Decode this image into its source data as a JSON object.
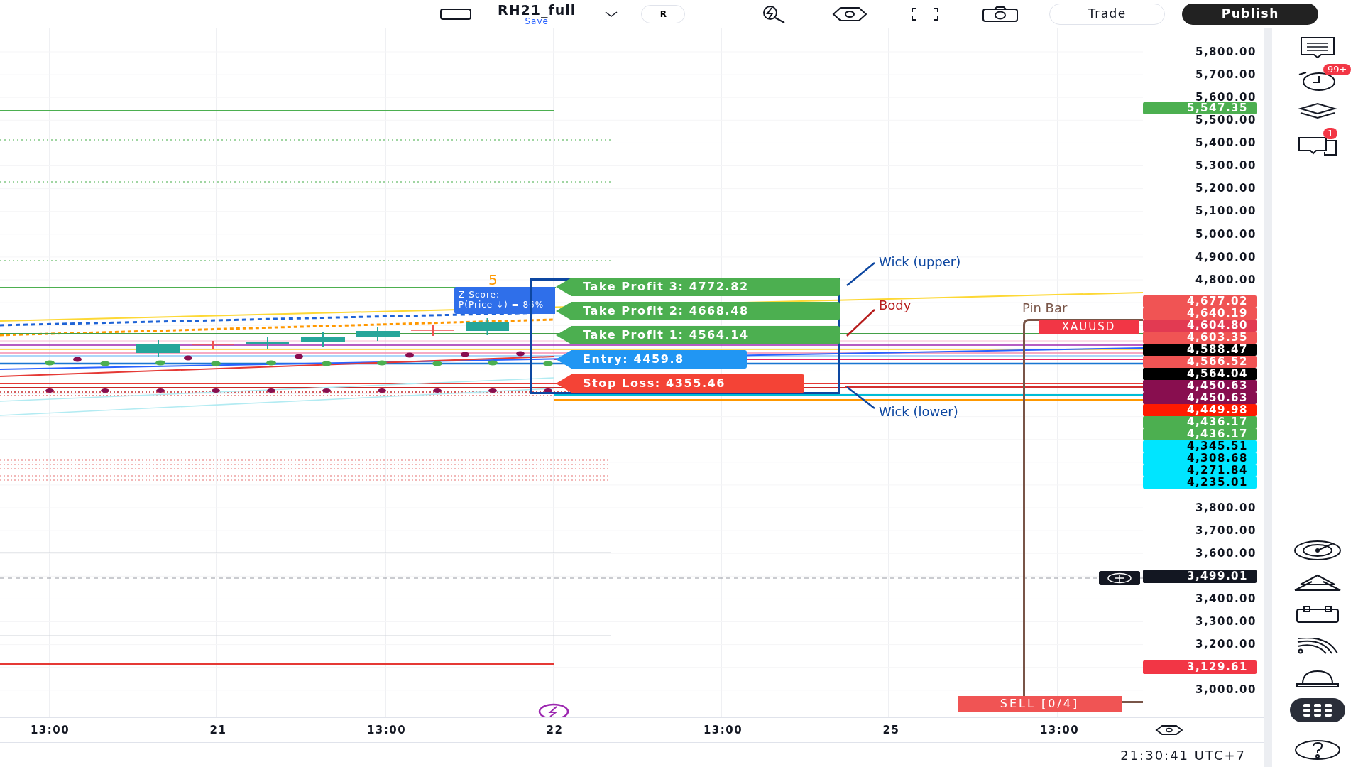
{
  "toolbar": {
    "title": "RH21_full",
    "subtitle": "Save",
    "symbol_button": "R",
    "buttons": [
      {
        "label": "Trade",
        "kind": "outline"
      },
      {
        "label": "Publish",
        "kind": "primary"
      }
    ]
  },
  "chart": {
    "price_axis": {
      "upper": [
        {
          "kind": "tick",
          "text": "5,800.00"
        },
        {
          "kind": "tick",
          "text": "5,700.00"
        },
        {
          "kind": "tick",
          "text": "5,600.00"
        },
        {
          "kind": "marker",
          "text": "5,547.35",
          "color": "#4caf50"
        },
        {
          "kind": "tick",
          "text": "5,500.00"
        },
        {
          "kind": "tick",
          "text": "5,400.00"
        },
        {
          "kind": "tick",
          "text": "5,300.00"
        },
        {
          "kind": "tick",
          "text": "5,200.00"
        },
        {
          "kind": "tick",
          "text": "5,100.00"
        },
        {
          "kind": "tick",
          "text": "5,000.00"
        },
        {
          "kind": "tick",
          "text": "4,900.00"
        },
        {
          "kind": "tick",
          "text": "4,800.00"
        }
      ],
      "tags": [
        {
          "text": "4,677.02",
          "color": "#f05454"
        },
        {
          "text": "4,640.19",
          "color": "#f05454"
        },
        {
          "text": "4,604.80",
          "color": "#e23a52"
        },
        {
          "text": "4,603.35",
          "color": "#f05454"
        },
        {
          "text": "4,588.47",
          "color": "#000000"
        },
        {
          "text": "4,566.52",
          "color": "#f05454"
        },
        {
          "text": "4,564.04",
          "color": "#000000"
        },
        {
          "text": "4,450.63",
          "color": "#880e4f"
        },
        {
          "text": "4,450.63",
          "color": "#880e4f"
        },
        {
          "text": "4,449.98",
          "color": "#ff1a00"
        },
        {
          "text": "4,436.17",
          "color": "#4caf50"
        },
        {
          "text": "4,436.17",
          "color": "#4caf50"
        },
        {
          "text": "4,345.51",
          "color": "#00e5ff"
        },
        {
          "text": "4,308.68",
          "color": "#00e5ff"
        },
        {
          "text": "4,271.84",
          "color": "#00e5ff"
        },
        {
          "text": "4,235.01",
          "color": "#00e5ff"
        }
      ],
      "lower": [
        {
          "kind": "tick",
          "text": "3,800.00"
        },
        {
          "kind": "tick",
          "text": "3,700.00"
        },
        {
          "kind": "tick",
          "text": "3,600.00"
        },
        {
          "kind": "tag",
          "text": "3,499.01",
          "color": "#131722"
        },
        {
          "kind": "tick",
          "text": "3,400.00"
        },
        {
          "kind": "tick",
          "text": "3,300.00"
        },
        {
          "kind": "tick",
          "text": "3,200.00"
        },
        {
          "kind": "tag",
          "text": "3,129.61",
          "color": "#f23645"
        },
        {
          "kind": "tick",
          "text": "3,000.00"
        }
      ]
    },
    "time_axis": [
      "13:00",
      "21",
      "13:00",
      "22",
      "13:00",
      "25",
      "13:00"
    ],
    "levels": [
      {
        "kind": "take_profit",
        "text": "Take Profit 3: 4772.82",
        "color": "#4caf50"
      },
      {
        "kind": "take_profit",
        "text": "Take Profit 2: 4668.48",
        "color": "#4caf50"
      },
      {
        "kind": "take_profit",
        "text": "Take Profit 1: 4564.14",
        "color": "#4caf50"
      },
      {
        "kind": "entry",
        "text": "Entry: 4459.8",
        "color": "#2196f3"
      },
      {
        "kind": "stop",
        "text": "Stop Loss: 4355.46",
        "color": "#f44336"
      }
    ],
    "z_score": {
      "marker": "5",
      "lines": [
        "Z-Score:",
        "P(Price ↓) = 86%"
      ]
    },
    "annotations": [
      {
        "text": "Wick (upper)",
        "color": "#0d47a1"
      },
      {
        "text": "Body",
        "color": "#b71c1c"
      },
      {
        "text": "Wick (lower)",
        "color": "#0d47a1"
      }
    ],
    "pattern": {
      "label": "Pin Bar",
      "symbol": "XAUUSD",
      "order": "SELL [0/4]"
    },
    "clock": "21:30:41 UTC+7"
  },
  "sidebar": {
    "top": [
      {
        "kind": "list"
      },
      {
        "kind": "alarm",
        "badge": "99+"
      },
      {
        "kind": "layers"
      },
      {
        "kind": "chat",
        "badge": "1"
      }
    ],
    "bottom": [
      {
        "kind": "target",
        "selected": false
      },
      {
        "kind": "stack",
        "selected": false
      },
      {
        "kind": "calendar",
        "selected": false
      },
      {
        "kind": "signal",
        "selected": false
      },
      {
        "kind": "bell",
        "selected": false
      },
      {
        "kind": "apps",
        "selected": true
      },
      {
        "kind": "help",
        "selected": false
      }
    ]
  }
}
